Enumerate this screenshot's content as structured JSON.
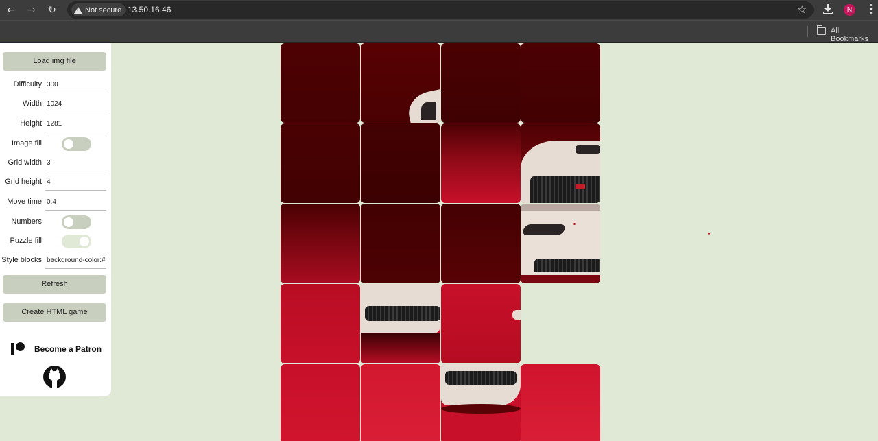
{
  "browser": {
    "security_label": "Not secure",
    "url": "13.50.16.46",
    "avatar_initial": "N",
    "bookmarks_label": "All Bookmarks"
  },
  "panel": {
    "load_button": "Load img file",
    "fields": [
      {
        "label": "Difficulty",
        "value": "300"
      },
      {
        "label": "Width",
        "value": "1024"
      },
      {
        "label": "Height",
        "value": "1281"
      },
      {
        "label": "Image fill",
        "toggle": false
      },
      {
        "label": "Grid width",
        "value": "3"
      },
      {
        "label": "Grid height",
        "value": "4"
      },
      {
        "label": "Move time",
        "value": "0.4"
      },
      {
        "label": "Numbers",
        "toggle": false
      },
      {
        "label": "Puzzle fill",
        "toggle": true
      },
      {
        "label": "Style blocks",
        "value": "background-color:#"
      }
    ],
    "refresh_button": "Refresh",
    "create_button": "Create HTML game",
    "patron_label": "Become a Patron"
  },
  "board": {
    "columns": 4,
    "rows": 5,
    "empty_slot": {
      "row": 3,
      "col": 3
    },
    "colors": {
      "dark": "#4a0102",
      "red": "#c8102a",
      "bright_red": "#d91e36",
      "car": "#e7dcd3",
      "background": "#dfe9d6"
    }
  }
}
